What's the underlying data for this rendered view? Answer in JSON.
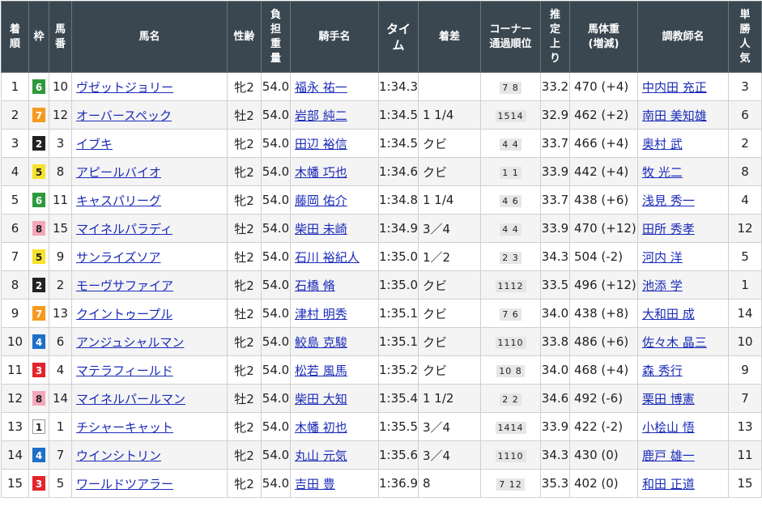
{
  "headers": {
    "rank": [
      "着",
      "順"
    ],
    "waku": [
      "枠"
    ],
    "umaban": [
      "馬",
      "番"
    ],
    "horse": [
      "馬名"
    ],
    "sexage": [
      "性齢"
    ],
    "weight": [
      "負",
      "担",
      "重",
      "量"
    ],
    "jockey": [
      "騎手名"
    ],
    "time": [
      "タイ",
      "ム"
    ],
    "margin": [
      "着差"
    ],
    "corner": [
      "コーナー",
      "通過順位"
    ],
    "last3f": [
      "推",
      "定",
      "上",
      "り"
    ],
    "bodyweight": [
      "馬体重",
      "(増減)"
    ],
    "trainer": [
      "調教師名"
    ],
    "pop": [
      "単",
      "勝",
      "人",
      "気"
    ]
  },
  "waku_colors": {
    "1": {
      "bg": "#ffffff",
      "fg": "#222222",
      "border": "#999999"
    },
    "2": {
      "bg": "#222222",
      "fg": "#ffffff",
      "border": "#222222"
    },
    "3": {
      "bg": "#e3242b",
      "fg": "#ffffff",
      "border": "#e3242b"
    },
    "4": {
      "bg": "#1e6fc8",
      "fg": "#ffffff",
      "border": "#1e6fc8"
    },
    "5": {
      "bg": "#f5e22a",
      "fg": "#222222",
      "border": "#f5e22a"
    },
    "6": {
      "bg": "#2e9a3c",
      "fg": "#ffffff",
      "border": "#2e9a3c"
    },
    "7": {
      "bg": "#f59a1e",
      "fg": "#ffffff",
      "border": "#f59a1e"
    },
    "8": {
      "bg": "#f4a7bb",
      "fg": "#222222",
      "border": "#f4a7bb"
    }
  },
  "rows": [
    {
      "rank": "1",
      "waku": "6",
      "umaban": "10",
      "horse": "ヴゼットジョリー",
      "sexage": "牝2",
      "weight": "54.0",
      "jockey": "福永 祐一",
      "time": "1:34.3",
      "margin": "",
      "corner": "7 8",
      "last3f": "33.2",
      "bodyweight": "470 (+4)",
      "trainer": "中内田 充正",
      "pop": "3"
    },
    {
      "rank": "2",
      "waku": "7",
      "umaban": "12",
      "horse": "オーバースペック",
      "sexage": "牡2",
      "weight": "54.0",
      "jockey": "岩部 純二",
      "time": "1:34.5",
      "margin": "1 1/4",
      "corner": "1514",
      "last3f": "32.9",
      "bodyweight": "462 (+2)",
      "trainer": "南田 美知雄",
      "pop": "6"
    },
    {
      "rank": "3",
      "waku": "2",
      "umaban": "3",
      "horse": "イブキ",
      "sexage": "牝2",
      "weight": "54.0",
      "jockey": "田辺 裕信",
      "time": "1:34.5",
      "margin": "クビ",
      "corner": "4 4",
      "last3f": "33.7",
      "bodyweight": "466 (+4)",
      "trainer": "奥村 武",
      "pop": "2"
    },
    {
      "rank": "4",
      "waku": "5",
      "umaban": "8",
      "horse": "アピールバイオ",
      "sexage": "牝2",
      "weight": "54.0",
      "jockey": "木幡 巧也",
      "time": "1:34.6",
      "margin": "クビ",
      "corner": "1 1",
      "last3f": "33.9",
      "bodyweight": "442 (+4)",
      "trainer": "牧 光二",
      "pop": "8"
    },
    {
      "rank": "5",
      "waku": "6",
      "umaban": "11",
      "horse": "キャスパリーグ",
      "sexage": "牝2",
      "weight": "54.0",
      "jockey": "藤岡 佑介",
      "time": "1:34.8",
      "margin": "1 1/4",
      "corner": "4 6",
      "last3f": "33.7",
      "bodyweight": "438 (+6)",
      "trainer": "浅見 秀一",
      "pop": "4"
    },
    {
      "rank": "6",
      "waku": "8",
      "umaban": "15",
      "horse": "マイネルパラディ",
      "sexage": "牡2",
      "weight": "54.0",
      "jockey": "柴田 未崎",
      "time": "1:34.9",
      "margin": "3／4",
      "corner": "4 4",
      "last3f": "33.9",
      "bodyweight": "470 (+12)",
      "trainer": "田所 秀孝",
      "pop": "12"
    },
    {
      "rank": "7",
      "waku": "5",
      "umaban": "9",
      "horse": "サンライズソア",
      "sexage": "牡2",
      "weight": "54.0",
      "jockey": "石川 裕紀人",
      "time": "1:35.0",
      "margin": "1／2",
      "corner": "2 3",
      "last3f": "34.3",
      "bodyweight": "504 (-2)",
      "trainer": "河内 洋",
      "pop": "5"
    },
    {
      "rank": "8",
      "waku": "2",
      "umaban": "2",
      "horse": "モーヴサファイア",
      "sexage": "牝2",
      "weight": "54.0",
      "jockey": "石橋 脩",
      "time": "1:35.0",
      "margin": "クビ",
      "corner": "1112",
      "last3f": "33.5",
      "bodyweight": "496 (+12)",
      "trainer": "池添 学",
      "pop": "1"
    },
    {
      "rank": "9",
      "waku": "7",
      "umaban": "13",
      "horse": "クイントゥープル",
      "sexage": "牡2",
      "weight": "54.0",
      "jockey": "津村 明秀",
      "time": "1:35.1",
      "margin": "クビ",
      "corner": "7 6",
      "last3f": "34.0",
      "bodyweight": "438 (+8)",
      "trainer": "大和田 成",
      "pop": "14"
    },
    {
      "rank": "10",
      "waku": "4",
      "umaban": "6",
      "horse": "アンジュシャルマン",
      "sexage": "牝2",
      "weight": "54.0",
      "jockey": "鮫島 克駿",
      "time": "1:35.1",
      "margin": "クビ",
      "corner": "1110",
      "last3f": "33.8",
      "bodyweight": "486 (+6)",
      "trainer": "佐々木 晶三",
      "pop": "10"
    },
    {
      "rank": "11",
      "waku": "3",
      "umaban": "4",
      "horse": "マテラフィールド",
      "sexage": "牝2",
      "weight": "54.0",
      "jockey": "松若 風馬",
      "time": "1:35.2",
      "margin": "クビ",
      "corner": "10 8",
      "last3f": "34.0",
      "bodyweight": "468 (+4)",
      "trainer": "森 秀行",
      "pop": "9"
    },
    {
      "rank": "12",
      "waku": "8",
      "umaban": "14",
      "horse": "マイネルパールマン",
      "sexage": "牡2",
      "weight": "54.0",
      "jockey": "柴田 大知",
      "time": "1:35.4",
      "margin": "1 1/2",
      "corner": "2 2",
      "last3f": "34.6",
      "bodyweight": "492 (-6)",
      "trainer": "栗田 博憲",
      "pop": "7"
    },
    {
      "rank": "13",
      "waku": "1",
      "umaban": "1",
      "horse": "チシャーキャット",
      "sexage": "牝2",
      "weight": "54.0",
      "jockey": "木幡 初也",
      "time": "1:35.5",
      "margin": "3／4",
      "corner": "1414",
      "last3f": "33.9",
      "bodyweight": "422 (-2)",
      "trainer": "小桧山 悟",
      "pop": "13"
    },
    {
      "rank": "14",
      "waku": "4",
      "umaban": "7",
      "horse": "ウインシトリン",
      "sexage": "牝2",
      "weight": "54.0",
      "jockey": "丸山 元気",
      "time": "1:35.6",
      "margin": "3／4",
      "corner": "1110",
      "last3f": "34.3",
      "bodyweight": "430 (0)",
      "trainer": "鹿戸 雄一",
      "pop": "11"
    },
    {
      "rank": "15",
      "waku": "3",
      "umaban": "5",
      "horse": "ワールドツアラー",
      "sexage": "牝2",
      "weight": "54.0",
      "jockey": "吉田 豊",
      "time": "1:36.9",
      "margin": "8",
      "corner": "7 12",
      "last3f": "35.3",
      "bodyweight": "402 (0)",
      "trainer": "和田 正道",
      "pop": "15"
    }
  ]
}
